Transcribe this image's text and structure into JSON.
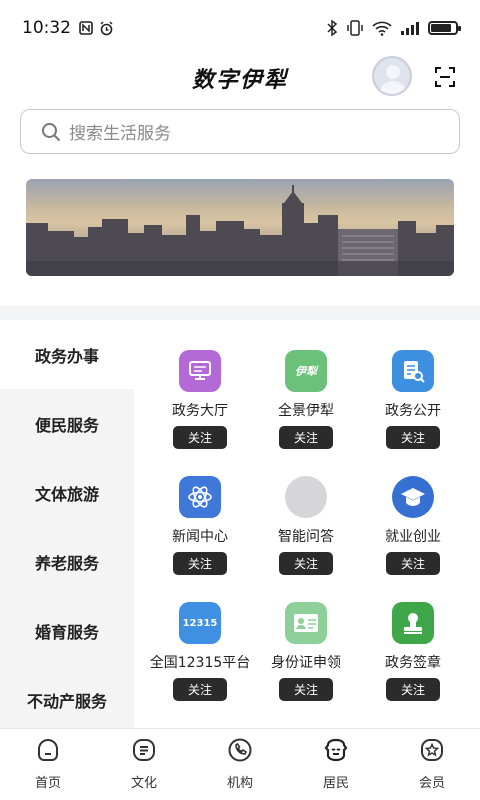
{
  "status_bar": {
    "time": "10:32",
    "left_icons": [
      "nfc-icon",
      "alarm-icon"
    ],
    "right_icons": [
      "bluetooth-icon",
      "vibrate-icon",
      "wifi-icon",
      "signal-icon"
    ],
    "battery_level": 0.85
  },
  "header": {
    "title": "数字伊犁",
    "avatar_icon": "user-avatar-icon",
    "scan_icon": "scan-icon"
  },
  "search": {
    "placeholder": "搜索生活服务"
  },
  "sidebar": {
    "items": [
      {
        "label": "政务办事",
        "active": true
      },
      {
        "label": "便民服务"
      },
      {
        "label": "文体旅游"
      },
      {
        "label": "养老服务"
      },
      {
        "label": "婚育服务"
      },
      {
        "label": "不动产服务"
      }
    ]
  },
  "services": [
    {
      "label": "政务大厅",
      "button": "关注",
      "icon": "monitor-icon",
      "color": "#b36ad6"
    },
    {
      "label": "全景伊犁",
      "button": "关注",
      "icon": "yili-logo-icon",
      "icon_text": "伊犁",
      "color": "#6cc17a"
    },
    {
      "label": "政务公开",
      "button": "关注",
      "icon": "document-search-icon",
      "color": "#3d8fe0"
    },
    {
      "label": "新闻中心",
      "button": "关注",
      "icon": "atom-icon",
      "color": "#3f78d8"
    },
    {
      "label": "智能问答",
      "button": "关注",
      "icon": "placeholder-icon",
      "color": "#d6d6d9"
    },
    {
      "label": "就业创业",
      "button": "关注",
      "icon": "graduation-cap-icon",
      "color": "#3570d2"
    },
    {
      "label": "全国12315平台",
      "button": "关注",
      "icon": "12315-logo-icon",
      "icon_text": "12315",
      "color": "#3f8fe2"
    },
    {
      "label": "身份证申领",
      "button": "关注",
      "icon": "id-card-icon",
      "color": "#8fd09a"
    },
    {
      "label": "政务签章",
      "button": "关注",
      "icon": "stamp-icon",
      "color": "#3fa64a"
    }
  ],
  "bottom_nav": [
    {
      "label": "首页",
      "icon": "home-icon"
    },
    {
      "label": "文化",
      "icon": "culture-icon"
    },
    {
      "label": "机构",
      "icon": "phone-icon"
    },
    {
      "label": "居民",
      "icon": "resident-icon",
      "active": true
    },
    {
      "label": "会员",
      "icon": "member-star-icon"
    }
  ]
}
